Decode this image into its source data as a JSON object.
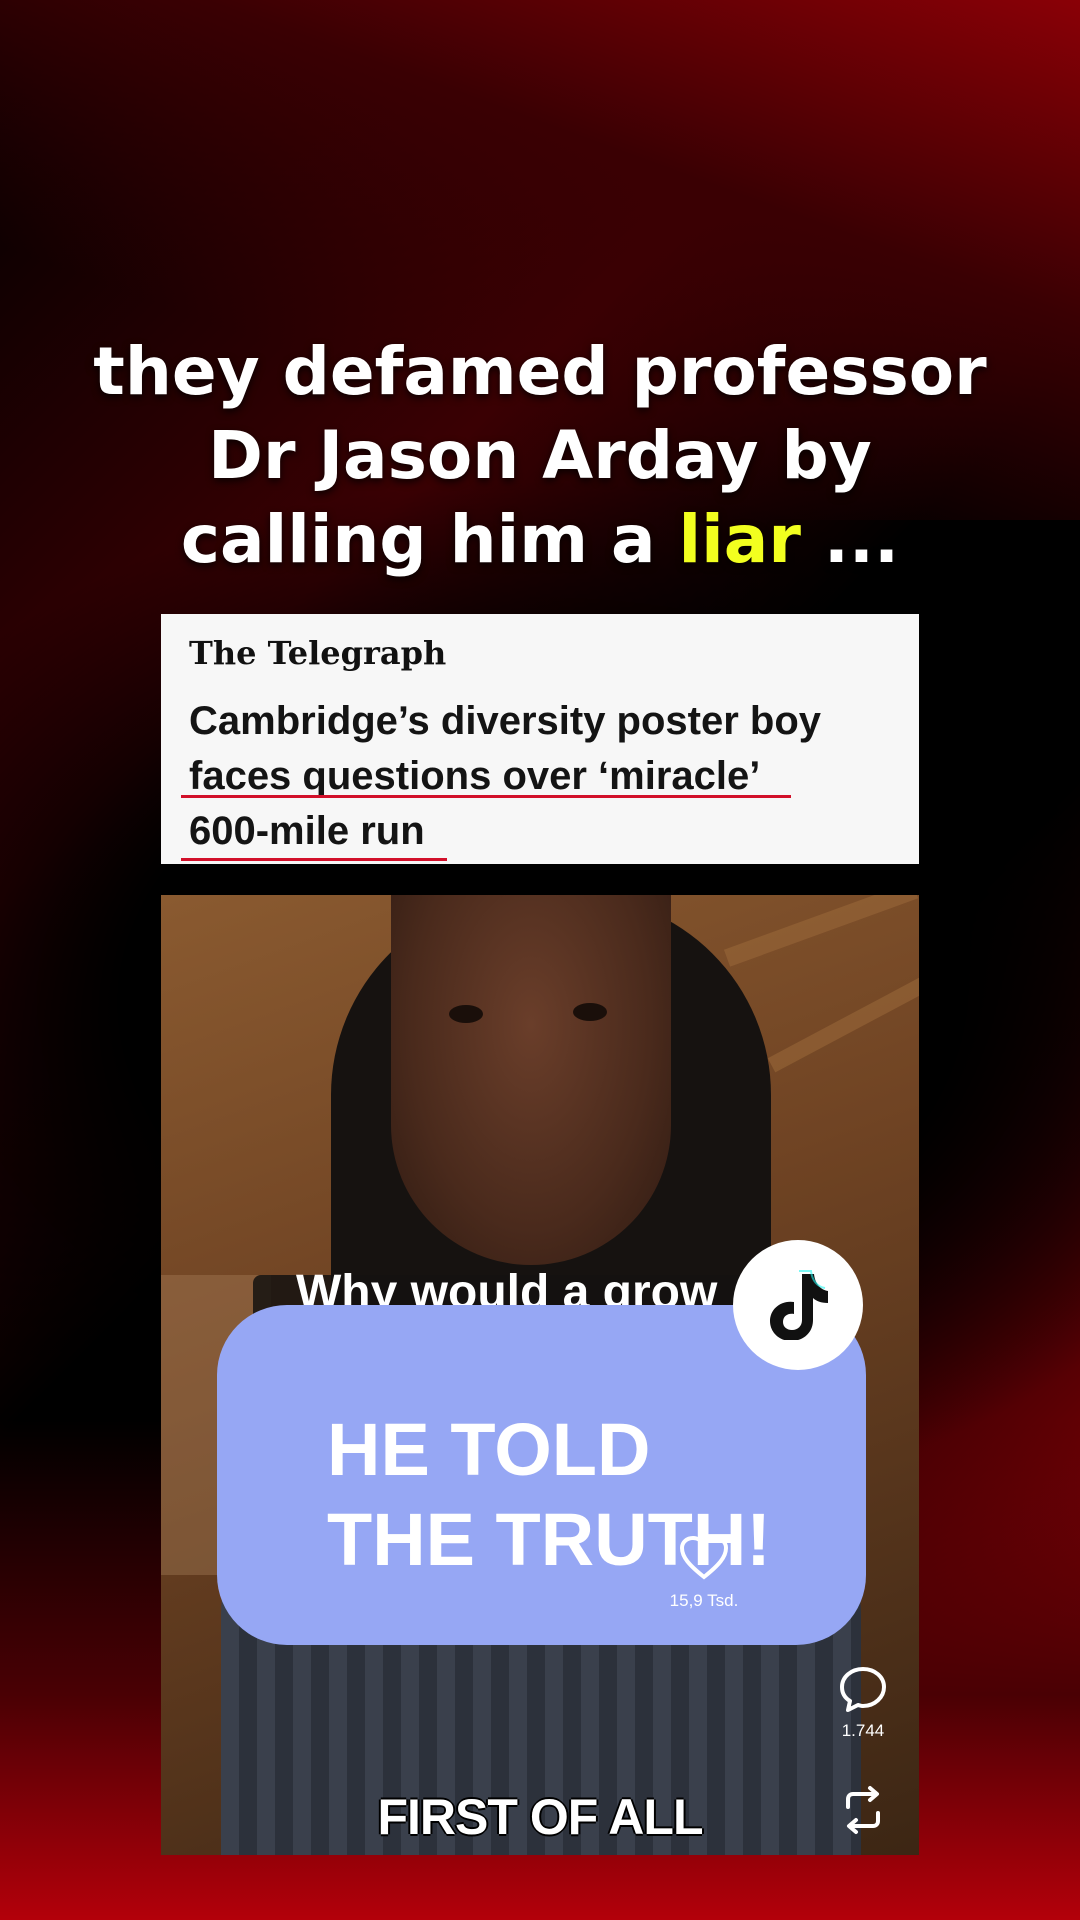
{
  "caption": {
    "line1": "they defamed professor",
    "line2": "Dr Jason Arday by",
    "line3_prefix": "calling him a ",
    "line3_highlight": "liar",
    "line3_suffix": " ..."
  },
  "news_card": {
    "source": "The Telegraph",
    "headline_line1": "Cambridge’s diversity poster boy",
    "headline_line2": "faces questions over ‘miracle’",
    "headline_line3": "600-mile run"
  },
  "video": {
    "subtitle_partial": "Why would a grow",
    "reply_bubble_line1": "HE TOLD",
    "reply_bubble_line2": "THE TRUTH!",
    "like_count": "15,9 Tsd.",
    "comment_count": "1.744",
    "bottom_subtitle": "FIRST OF ALL"
  },
  "icons": [
    "tiktok-logo-icon",
    "heart-icon",
    "comment-icon",
    "repost-icon"
  ],
  "colors": {
    "highlight": "#f2ff1f",
    "bubble": "#96a7f4",
    "underline": "#d2102a"
  }
}
